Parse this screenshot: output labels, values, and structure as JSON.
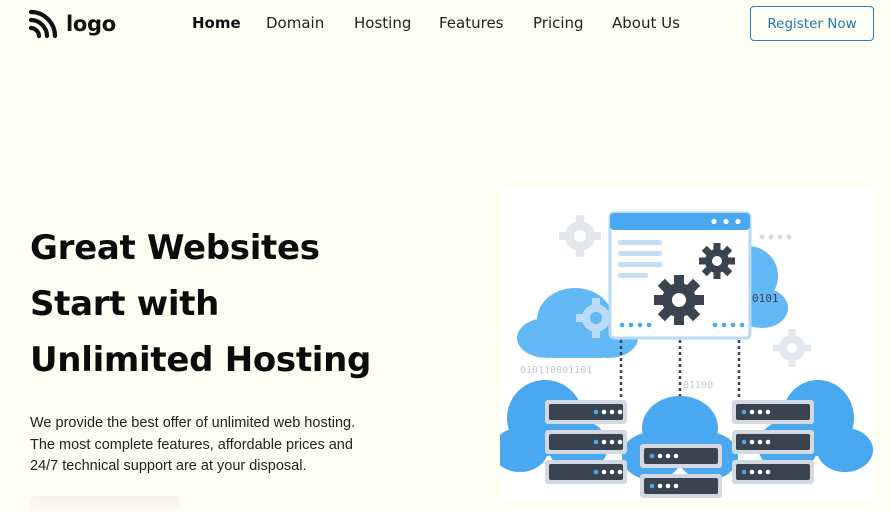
{
  "brand": {
    "logo_text": "logo",
    "logo_icon": "rss-feed-icon"
  },
  "nav": {
    "items": [
      {
        "label": "Home",
        "active": true
      },
      {
        "label": "Domain",
        "active": false
      },
      {
        "label": "Hosting",
        "active": false
      },
      {
        "label": "Features",
        "active": false
      },
      {
        "label": "Pricing",
        "active": false
      },
      {
        "label": "About Us",
        "active": false
      }
    ],
    "register_label": "Register Now"
  },
  "hero": {
    "title_lines": [
      "Great Websites",
      "Start with",
      "Unlimited Hosting"
    ],
    "description_lines": [
      "We provide the best offer of unlimited web hosting.",
      "The most complete features, affordable prices and",
      "24/7 technical support are at your disposal."
    ],
    "illustration": {
      "binary_labels": [
        "0101",
        "010110001101",
        "01100"
      ]
    }
  },
  "colors": {
    "background": "#fefef2",
    "accent": "#2476b8",
    "cloud_blue": "#4aa8f0",
    "server_gray": "#d3d9e2",
    "gear_dark": "#3a4350"
  }
}
